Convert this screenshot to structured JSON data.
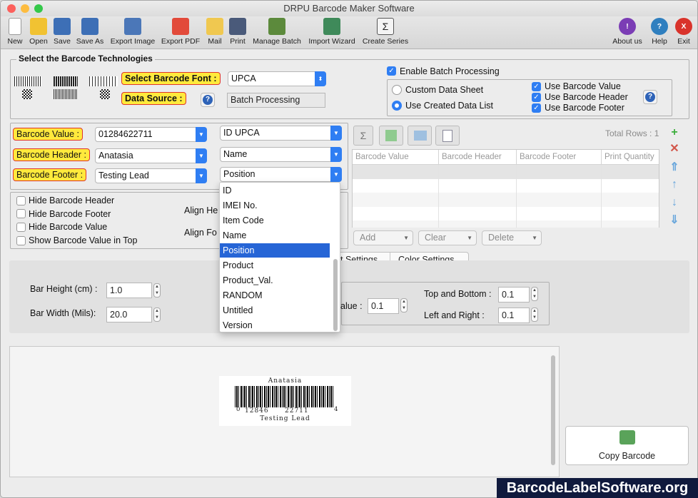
{
  "window": {
    "title": "DRPU Barcode Maker Software"
  },
  "toolbar": {
    "items": [
      "New",
      "Open",
      "Save",
      "Save As",
      "Export Image",
      "Export PDF",
      "Mail",
      "Print",
      "Manage Batch",
      "Import Wizard",
      "Create Series"
    ],
    "right": [
      "About us",
      "Help",
      "Exit"
    ]
  },
  "tech": {
    "legend": "Select the Barcode Technologies",
    "font_label": "Select Barcode Font :",
    "font_value": "UPCA",
    "source_label": "Data Source :",
    "source_value": "Batch Processing",
    "batch_enable": "Enable Batch Processing",
    "custom_sheet": "Custom Data Sheet",
    "created_list": "Use Created Data List",
    "use_value": "Use Barcode Value",
    "use_header": "Use Barcode Header",
    "use_footer": "Use Barcode Footer"
  },
  "fields": {
    "value_label": "Barcode Value :",
    "value_input": "01284622711",
    "value_col": "ID UPCA",
    "header_label": "Barcode Header :",
    "header_input": "Anatasia",
    "header_col": "Name",
    "footer_label": "Barcode Footer :",
    "footer_input": "Testing Lead",
    "footer_col": "Position"
  },
  "options": {
    "hide_header": "Hide Barcode Header",
    "hide_footer": "Hide Barcode Footer",
    "hide_value": "Hide Barcode Value",
    "show_top": "Show Barcode Value in Top",
    "align_he": "Align He",
    "align_fo": "Align Fo"
  },
  "dropdown": {
    "items": [
      "ID",
      "IMEI No.",
      "Item Code",
      "Name",
      "Position",
      "Product",
      "Product_Val.",
      "RANDOM",
      "Untitled",
      "Version"
    ],
    "selected": "Position"
  },
  "grid": {
    "total_rows": "Total Rows : 1",
    "columns": [
      "Barcode Value",
      "Barcode Header",
      "Barcode Footer",
      "Print Quantity"
    ],
    "add": "Add",
    "clear": "Clear",
    "delete": "Delete"
  },
  "tabs": {
    "settings": "t Settings",
    "color": "Color Settings"
  },
  "settings": {
    "bar_height_label": "Bar Height (cm) :",
    "bar_height": "1.0",
    "bar_width_label": "Bar Width (Mils):",
    "bar_width": "20.0",
    "value_label": "alue :",
    "value": "0.1",
    "top_bottom_label": "Top and Bottom :",
    "top_bottom": "0.1",
    "left_right_label": "Left and Right :",
    "left_right": "0.1"
  },
  "preview": {
    "header": "Anatasia",
    "digits_left": "0",
    "digits_a": "12846",
    "digits_b": "22711",
    "digits_right": "4",
    "footer": "Testing Lead"
  },
  "copy_button": "Copy Barcode",
  "watermark": "BarcodeLabelSoftware.org"
}
